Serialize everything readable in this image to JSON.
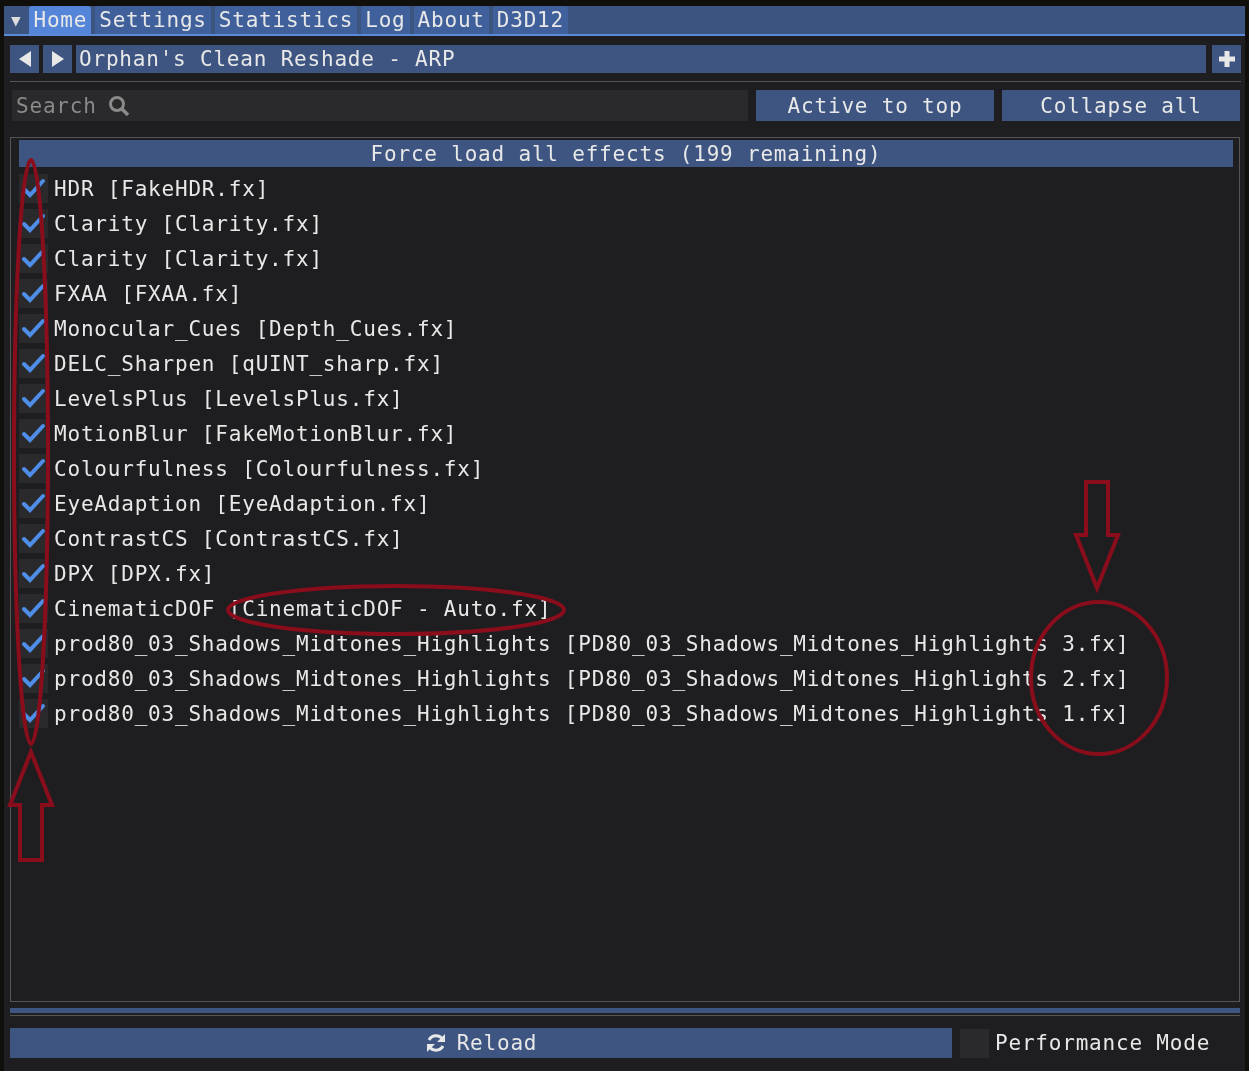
{
  "menu_icon": "▼",
  "tabs": [
    {
      "label": "Home",
      "selected": true
    },
    {
      "label": "Settings",
      "selected": false
    },
    {
      "label": "Statistics",
      "selected": false
    },
    {
      "label": "Log",
      "selected": false
    },
    {
      "label": "About",
      "selected": false
    },
    {
      "label": "D3D12",
      "selected": false
    }
  ],
  "preset": {
    "name": "Orphan's Clean Reshade - ARP"
  },
  "search": {
    "placeholder": "Search"
  },
  "buttons": [
    "Active to top",
    "Collapse all"
  ],
  "force_load": "Force load all effects (199 remaining)",
  "effects": [
    {
      "label": "HDR [FakeHDR.fx]",
      "checked": true
    },
    {
      "label": "Clarity [Clarity.fx]",
      "checked": true
    },
    {
      "label": "Clarity [Clarity.fx]",
      "checked": true
    },
    {
      "label": "FXAA [FXAA.fx]",
      "checked": true
    },
    {
      "label": "Monocular_Cues [Depth_Cues.fx]",
      "checked": true
    },
    {
      "label": "DELC_Sharpen [qUINT_sharp.fx]",
      "checked": true
    },
    {
      "label": "LevelsPlus [LevelsPlus.fx]",
      "checked": true
    },
    {
      "label": "MotionBlur [FakeMotionBlur.fx]",
      "checked": true
    },
    {
      "label": "Colourfulness [Colourfulness.fx]",
      "checked": true
    },
    {
      "label": "EyeAdaption [EyeAdaption.fx]",
      "checked": true
    },
    {
      "label": "ContrastCS [ContrastCS.fx]",
      "checked": true
    },
    {
      "label": "DPX [DPX.fx]",
      "checked": true
    },
    {
      "label": "CinematicDOF [CinematicDOF - Auto.fx]",
      "checked": true
    },
    {
      "label": "prod80_03_Shadows_Midtones_Highlights [PD80_03_Shadows_Midtones_Highlights 3.fx]",
      "checked": true
    },
    {
      "label": "prod80_03_Shadows_Midtones_Highlights [PD80_03_Shadows_Midtones_Highlights 2.fx]",
      "checked": true
    },
    {
      "label": "prod80_03_Shadows_Midtones_Highlights [PD80_03_Shadows_Midtones_Highlights 1.fx]",
      "checked": true
    }
  ],
  "reload": "Reload",
  "performance_mode": {
    "label": "Performance Mode",
    "checked": false
  }
}
